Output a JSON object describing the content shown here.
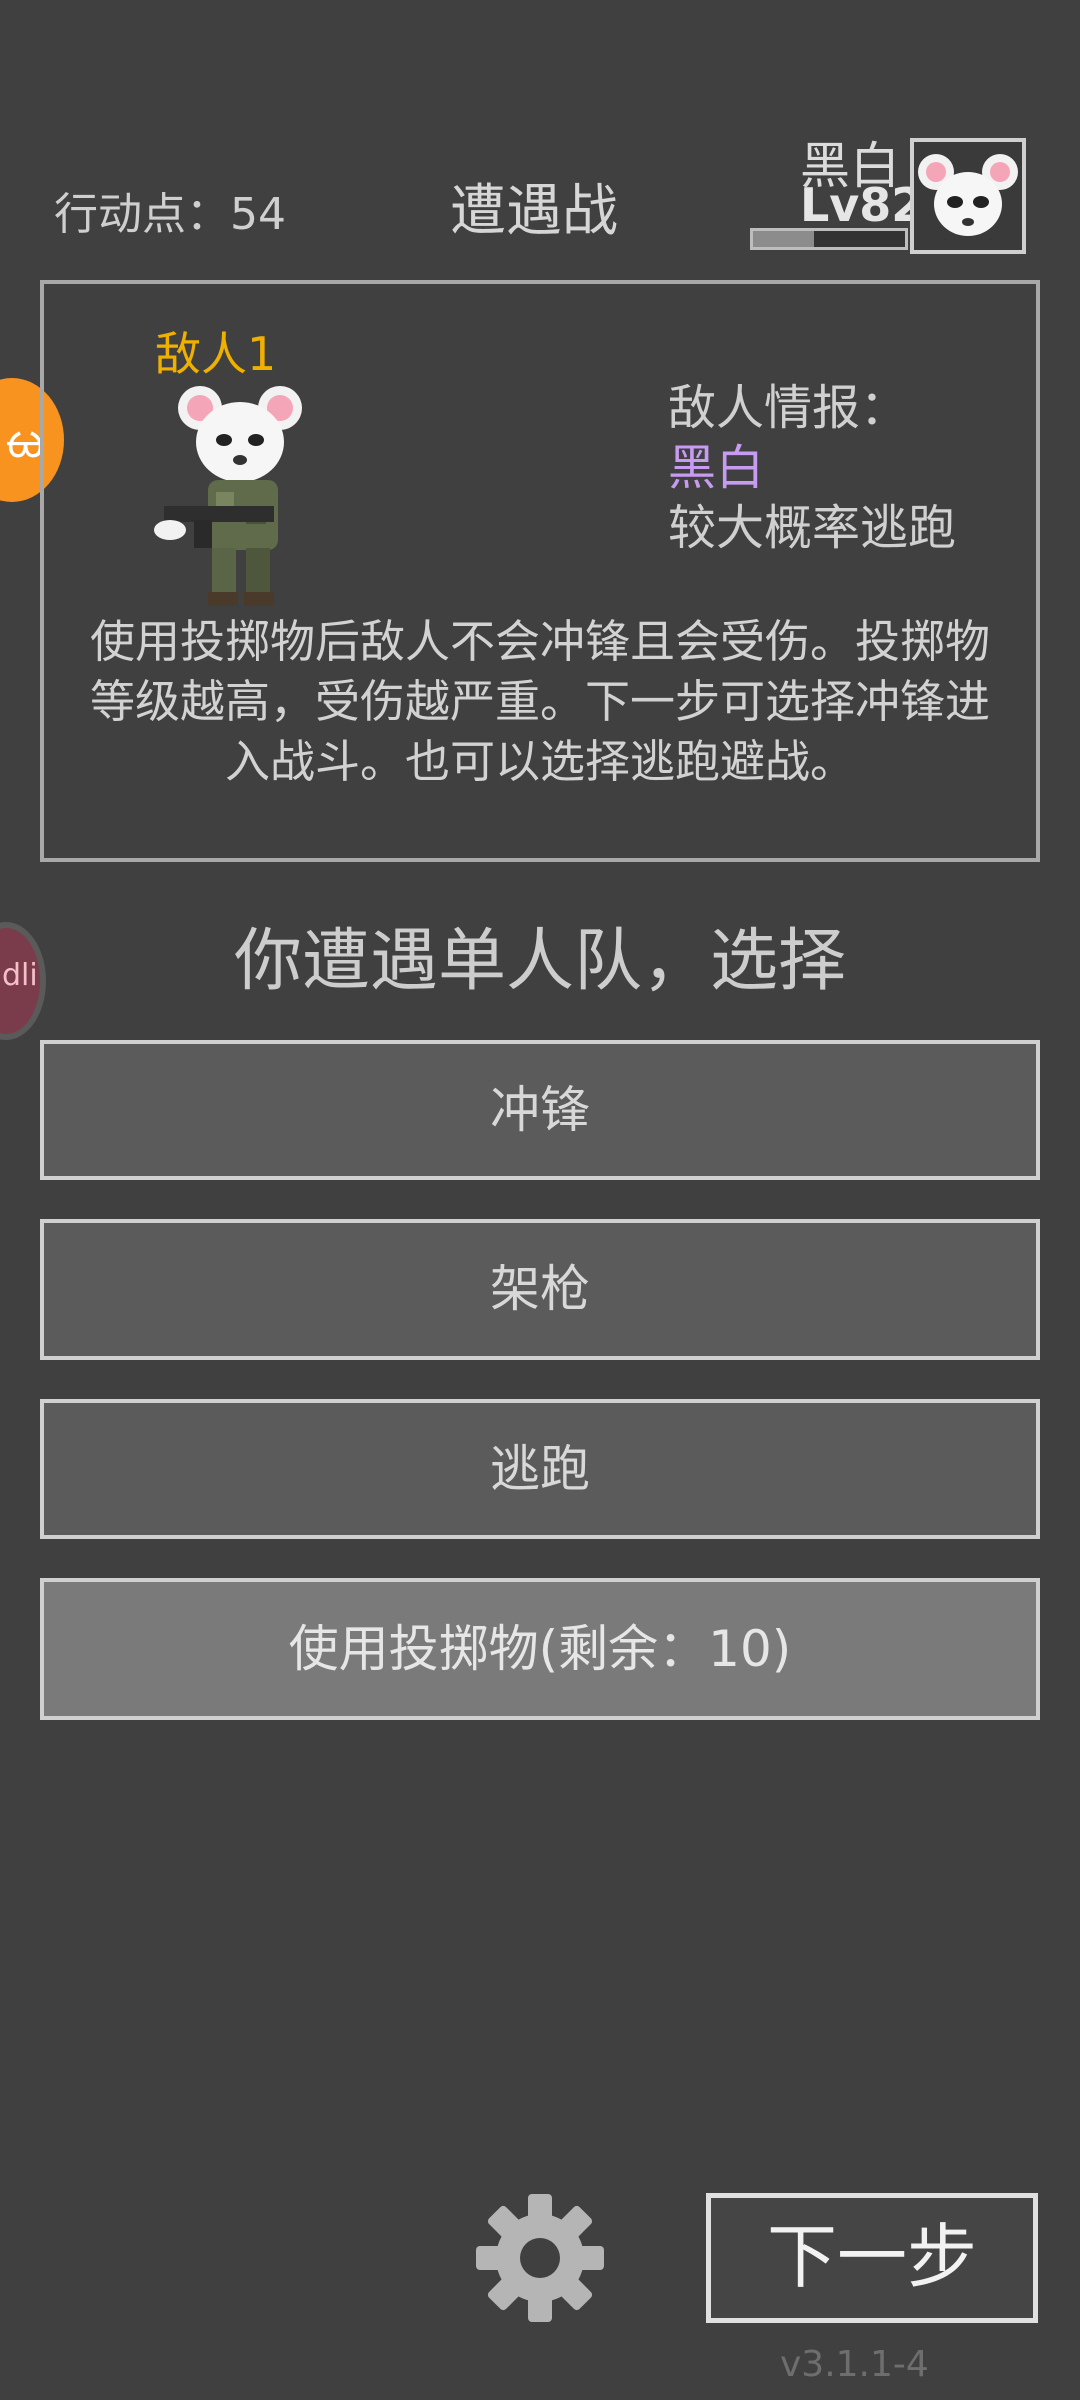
{
  "header": {
    "action_points": "行动点：54",
    "title": "遭遇战",
    "player_name": "黑白",
    "player_level": "Lv82",
    "player_xp_fraction": 0.4
  },
  "enemy_panel": {
    "enemy_label": "敌人1",
    "intel_title": "敌人情报：",
    "intel_name": "黑白",
    "intel_trait": "较大概率逃跑",
    "description": "使用投掷物后敌人不会冲锋且会受伤。投掷物等级越高，受伤越严重。下一步可选择冲锋进入战斗。也可以选择逃跑避战。"
  },
  "encounter_text": "你遭遇单人队，选择",
  "choices": {
    "charge": "冲锋",
    "setup_gun": "架枪",
    "flee": "逃跑",
    "throwable": "使用投掷物(剩余：10)"
  },
  "footer": {
    "next": "下一步",
    "version": "v3.1.1-4"
  },
  "side_icons": {
    "orange_icon": "ᰄ",
    "pink_icon": "dli"
  },
  "colors": {
    "background": "#404040",
    "enemy_label": "#f0b000",
    "intel_name": "#c79bf2",
    "side_orange": "#f7931e"
  }
}
